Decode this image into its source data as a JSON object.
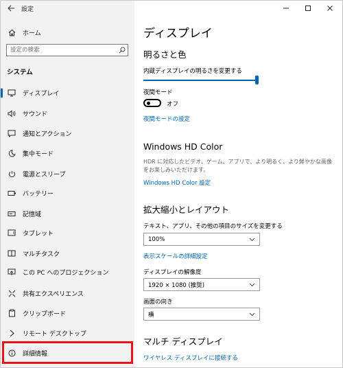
{
  "window": {
    "title": "設定",
    "back_icon": "back-arrow-icon"
  },
  "sidebar": {
    "home_label": "ホーム",
    "search_placeholder": "設定の検索",
    "section_title": "システム",
    "items": [
      {
        "label": "ディスプレイ",
        "icon": "display-icon",
        "active": true
      },
      {
        "label": "サウンド",
        "icon": "speaker-icon"
      },
      {
        "label": "通知とアクション",
        "icon": "notification-icon"
      },
      {
        "label": "集中モード",
        "icon": "moon-icon"
      },
      {
        "label": "電源とスリープ",
        "icon": "power-icon"
      },
      {
        "label": "バッテリー",
        "icon": "battery-icon"
      },
      {
        "label": "記憶域",
        "icon": "storage-icon"
      },
      {
        "label": "タブレット",
        "icon": "tablet-icon"
      },
      {
        "label": "マルチタスク",
        "icon": "multitask-icon"
      },
      {
        "label": "この PC へのプロジェクション",
        "icon": "projection-icon"
      },
      {
        "label": "共有エクスペリエンス",
        "icon": "shared-icon"
      },
      {
        "label": "クリップボード",
        "icon": "clipboard-icon"
      },
      {
        "label": "リモート デスクトップ",
        "icon": "remote-desktop-icon"
      },
      {
        "label": "詳細情報",
        "icon": "info-icon"
      }
    ]
  },
  "content": {
    "page_title": "ディスプレイ",
    "brightness": {
      "heading": "明るさと色",
      "slider_label": "内蔵ディスプレイの明るさを変更する",
      "level": 1.0
    },
    "night_light": {
      "label": "夜間モード",
      "state": "オフ",
      "settings_link": "夜間モードの設定"
    },
    "hdr": {
      "heading": "Windows HD Color",
      "description": "HDR に対応したビデオ、ゲーム、アプリで、より明るく、より鮮やかな画像をお楽しみいただけます。",
      "link": "Windows HD Color 設定"
    },
    "scale": {
      "heading": "拡大縮小とレイアウト",
      "size_label": "テキスト、アプリ、その他の項目のサイズを変更する",
      "size_value": "100%",
      "advanced_link": "表示スケールの詳細設定",
      "resolution_label": "ディスプレイの解像度",
      "resolution_value": "1920 × 1080 (推奨)",
      "orientation_label": "画面の向き",
      "orientation_value": "横"
    },
    "multi": {
      "heading": "マルチ ディスプレイ",
      "link": "ワイヤレス ディスプレイに接続する"
    }
  }
}
